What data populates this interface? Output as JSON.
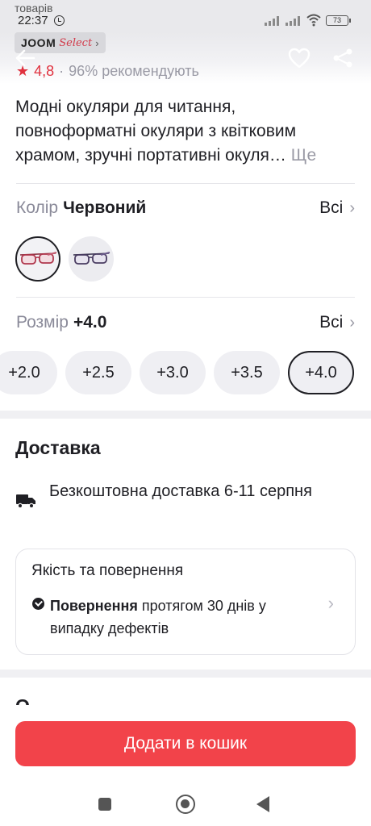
{
  "status_bar": {
    "time": "22:37",
    "behind_text": "товарів",
    "battery": "73"
  },
  "header": {
    "brand": "JOOM",
    "brand_sub": "Select",
    "brand_chevron": "›"
  },
  "rating": {
    "value": "4,8",
    "separator": "·",
    "recommend": "96% рекомендують"
  },
  "product": {
    "title": "Модні окуляри для читання, повноформатні окуляри з квітковим храмом, зручні портативні окуля…",
    "more_label": "Ще"
  },
  "color": {
    "label": "Колір",
    "value": "Червоний",
    "all_label": "Всі",
    "options": [
      "red-frame",
      "purple-frame"
    ],
    "selected_index": 0
  },
  "size": {
    "label": "Розмір",
    "value": "+4.0",
    "all_label": "Всі",
    "options": [
      "+2.0",
      "+2.5",
      "+3.0",
      "+3.5",
      "+4.0"
    ],
    "selected_index": 4
  },
  "delivery": {
    "title": "Доставка",
    "text": "Безкоштовна доставка 6-11 серпня"
  },
  "quality": {
    "title": "Якість та повернення",
    "return_bold": "Повернення",
    "return_text": " протягом 30 днів у випадку дефектів"
  },
  "next_section": {
    "title": "О"
  },
  "cart": {
    "button_label": "Додати в кошик"
  },
  "colors": {
    "accent": "#f2434a",
    "rating": "#e0313e",
    "muted": "#9a9aa5"
  }
}
